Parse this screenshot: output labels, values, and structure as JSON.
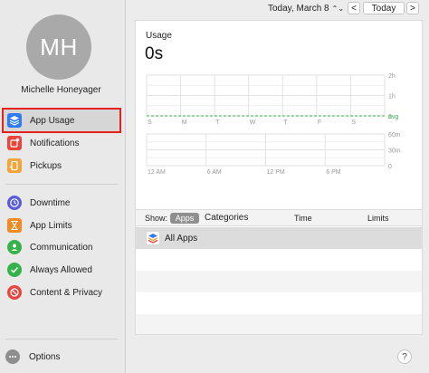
{
  "user": {
    "initials": "MH",
    "name": "Michelle Honeyager"
  },
  "sidebar": {
    "items": [
      {
        "label": "App Usage",
        "icon": "layers-icon",
        "color": "#2f7bf5"
      },
      {
        "label": "Notifications",
        "icon": "notification-icon",
        "color": "#e8453c"
      },
      {
        "label": "Pickups",
        "icon": "pickup-icon",
        "color": "#f2a33a"
      },
      {
        "label": "Downtime",
        "icon": "downtime-icon",
        "color": "#5a5bd6"
      },
      {
        "label": "App Limits",
        "icon": "hourglass-icon",
        "color": "#f08a24"
      },
      {
        "label": "Communication",
        "icon": "communication-icon",
        "color": "#36b24a"
      },
      {
        "label": "Always Allowed",
        "icon": "checkmark-icon",
        "color": "#36b24a"
      },
      {
        "label": "Content & Privacy",
        "icon": "restricted-icon",
        "color": "#e8453c"
      }
    ],
    "options_label": "Options"
  },
  "topbar": {
    "date_label": "Today, March 8",
    "stepper_glyph": "⌃⌄",
    "prev": "<",
    "today": "Today",
    "next": ">"
  },
  "usage": {
    "title": "Usage",
    "total": "0s"
  },
  "chart_data": [
    {
      "type": "bar",
      "categories": [
        "S",
        "M",
        "T",
        "W",
        "T",
        "F",
        "S"
      ],
      "values": [
        0,
        0,
        0,
        0,
        0,
        0,
        0
      ],
      "y_ticks": [
        "2h",
        "1h",
        "0"
      ],
      "ylim": [
        0,
        2
      ],
      "average_label": "avg",
      "average_color": "#36b24a"
    },
    {
      "type": "bar",
      "categories": [
        "12 AM",
        "6 AM",
        "12 PM",
        "6 PM"
      ],
      "values": [
        0,
        0,
        0,
        0
      ],
      "y_ticks": [
        "60m",
        "30m",
        "0"
      ],
      "ylim": [
        0,
        60
      ]
    }
  ],
  "list": {
    "show_label": "Show:",
    "apps_tab": "Apps",
    "categories_tab": "Categories",
    "col_time": "Time",
    "col_limits": "Limits",
    "rows": [
      {
        "label": "All Apps",
        "icon": "layers-icon"
      }
    ]
  },
  "help": "?"
}
